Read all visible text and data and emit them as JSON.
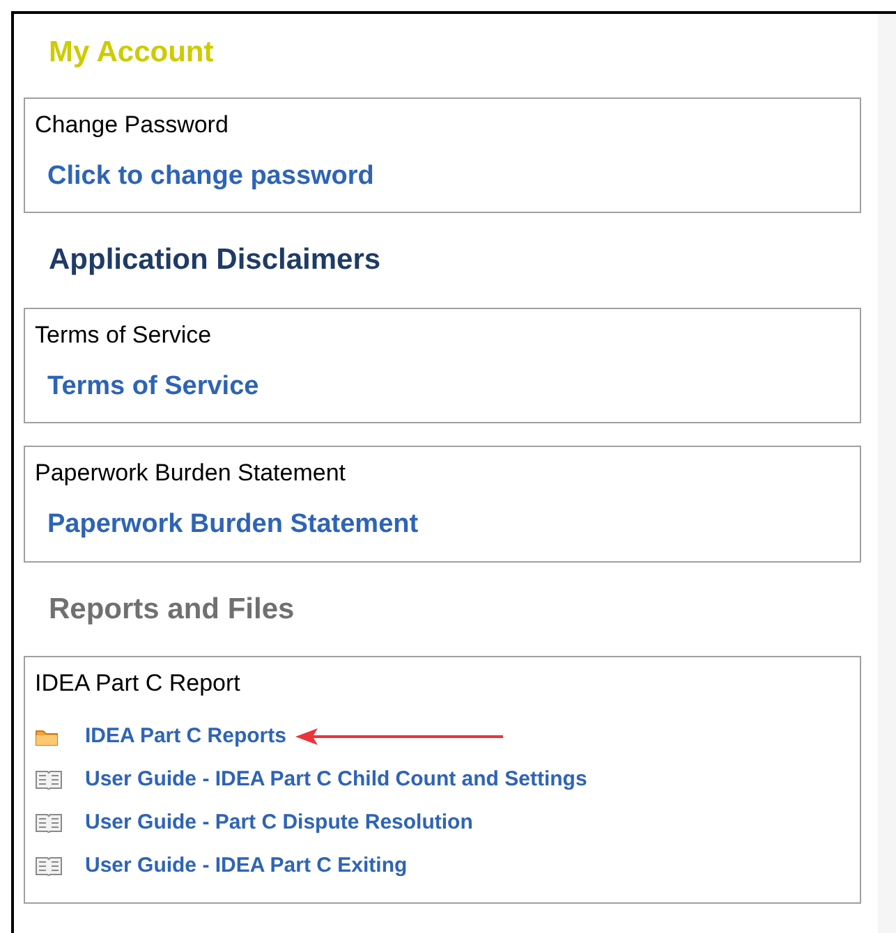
{
  "sections": [
    {
      "heading": "My Account",
      "kind": "accent",
      "boxes": [
        {
          "title": "Change Password",
          "links": [
            {
              "label": "Click to change password",
              "kind": "plain"
            }
          ]
        }
      ]
    },
    {
      "heading": "Application Disclaimers",
      "kind": "primary",
      "boxes": [
        {
          "title": "Terms of Service",
          "links": [
            {
              "label": "Terms of Service",
              "kind": "plain"
            }
          ]
        },
        {
          "title": "Paperwork Burden Statement",
          "links": [
            {
              "label": "Paperwork Burden Statement",
              "kind": "plain"
            }
          ]
        }
      ]
    },
    {
      "heading": "Reports and Files",
      "kind": "muted",
      "boxes": [
        {
          "title": "IDEA Part C Report",
          "links": [
            {
              "label": "IDEA Part C Reports",
              "kind": "folder",
              "annotated": true
            },
            {
              "label": "User Guide - IDEA Part C Child Count and Settings",
              "kind": "document",
              "annotated": false
            },
            {
              "label": "User Guide - Part C Dispute Resolution",
              "kind": "document",
              "annotated": false
            },
            {
              "label": "User Guide - IDEA Part C Exiting",
              "kind": "document",
              "annotated": false
            }
          ]
        }
      ]
    }
  ]
}
